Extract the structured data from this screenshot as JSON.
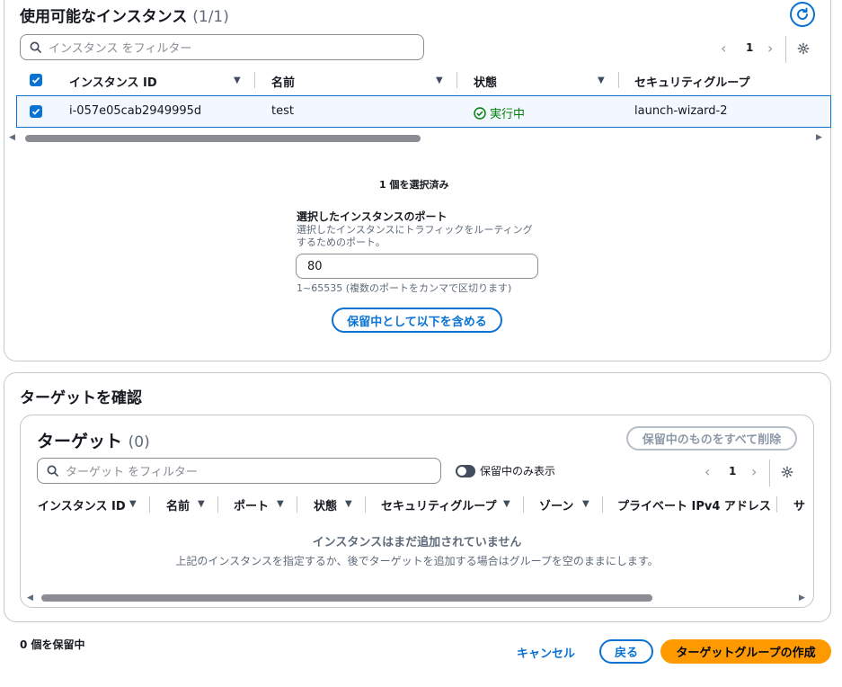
{
  "available": {
    "title": "使用可能なインスタンス",
    "count": "(1/1)",
    "filter_placeholder": "インスタンス をフィルター",
    "page": "1",
    "columns": [
      "インスタンス ID",
      "名前",
      "状態",
      "セキュリティグループ"
    ],
    "row": {
      "instance_id": "i-057e05cab2949995d",
      "name": "test",
      "status": "実行中",
      "security_group": "launch-wizard-2"
    },
    "selected_count": "1 個を選択済み",
    "port_label": "選択したインスタンスのポート",
    "port_desc_line1": "選択したインスタンスにトラフィックをルーティング",
    "port_desc_line2": "するためのポート。",
    "port_value": "80",
    "port_hint": "1~65535 (複数のポートをカンマで区切ります)",
    "include_button": "保留中として以下を含める"
  },
  "review": {
    "title": "ターゲットを確認",
    "targets_title": "ターゲット",
    "targets_count": "(0)",
    "remove_all_button": "保留中のものをすべて削除",
    "filter_placeholder": "ターゲット をフィルター",
    "toggle_label": "保留中のみ表示",
    "page": "1",
    "columns": [
      "インスタンス ID",
      "名前",
      "ポート",
      "状態",
      "セキュリティグループ",
      "ゾーン",
      "プライベート IPv4 アドレス",
      "サブ"
    ],
    "empty_title": "インスタンスはまだ追加されていません",
    "empty_desc": "上記のインスタンスを指定するか、後でターゲットを追加する場合はグループを空のままにします。"
  },
  "footer": {
    "pending_count": "0 個を保留中",
    "cancel": "キャンセル",
    "back": "戻る",
    "create": "ターゲットグループの作成"
  },
  "colors": {
    "accent": "#0972d3",
    "primary": "#ff9900",
    "success": "#037f0c"
  }
}
